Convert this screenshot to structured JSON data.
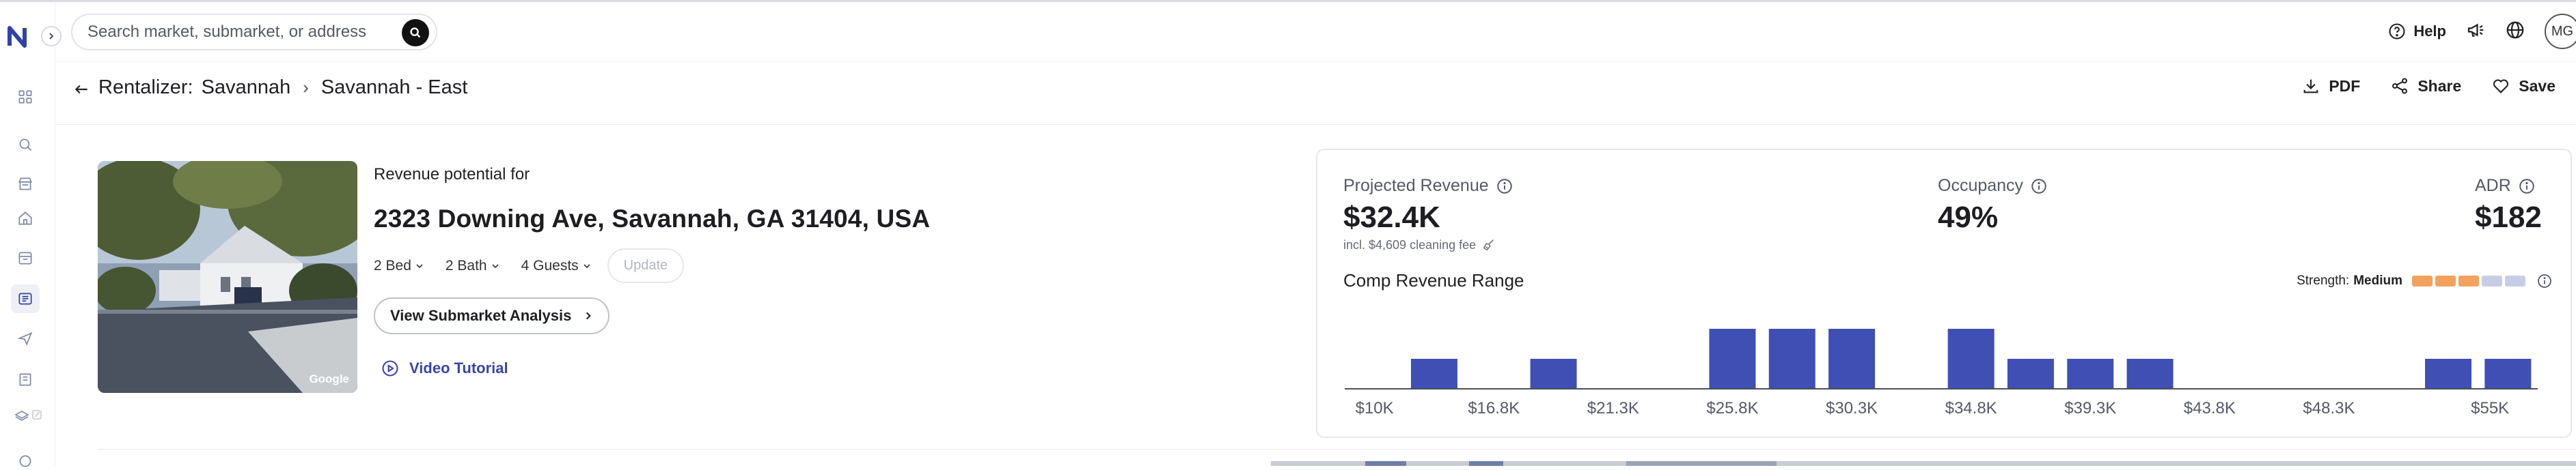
{
  "search": {
    "placeholder": "Search market, submarket, or address"
  },
  "topbar": {
    "help_label": "Help",
    "avatar_initials": "MG"
  },
  "breadcrumb": {
    "product": "Rentalizer:",
    "market": "Savannah",
    "submarket": "Savannah - East"
  },
  "actions": {
    "pdf": "PDF",
    "share": "Share",
    "save": "Save"
  },
  "property": {
    "revenue_for_label": "Revenue potential for",
    "address": "2323 Downing Ave, Savannah, GA 31404, USA",
    "photo_credit": "Google",
    "beds": "2 Bed",
    "baths": "2 Bath",
    "guests": "4 Guests",
    "update_label": "Update",
    "submarket_button": "View Submarket Analysis",
    "video_link": "Video Tutorial"
  },
  "metrics": {
    "projected_revenue_label": "Projected Revenue",
    "projected_revenue_value": "$32.4K",
    "cleaning_note": "incl. $4,609 cleaning fee",
    "occupancy_label": "Occupancy",
    "occupancy_value": "49%",
    "adr_label": "ADR",
    "adr_value": "$182",
    "range_title": "Comp Revenue Range",
    "strength_label": "Strength:",
    "strength_value": "Medium",
    "strength_segments_filled": 3,
    "strength_segments_total": 5
  },
  "chart_data": {
    "type": "bar",
    "title": "Comp Revenue Range",
    "tick_labels": [
      "$10K",
      "$16.8K",
      "$21.3K",
      "$25.8K",
      "$30.3K",
      "$34.8K",
      "$39.3K",
      "$43.8K",
      "$48.3K",
      "$55K"
    ],
    "values": [
      0,
      1,
      0,
      1,
      0,
      0,
      2,
      2,
      2,
      0,
      2,
      1,
      1,
      1,
      0,
      0,
      0,
      0,
      1,
      1
    ],
    "ylim": [
      0,
      2
    ],
    "color": "#3f4fb4"
  },
  "colors": {
    "accent": "#3f4fb4",
    "strength_filled": "#f2a25c",
    "strength_empty": "#c8cde6"
  }
}
